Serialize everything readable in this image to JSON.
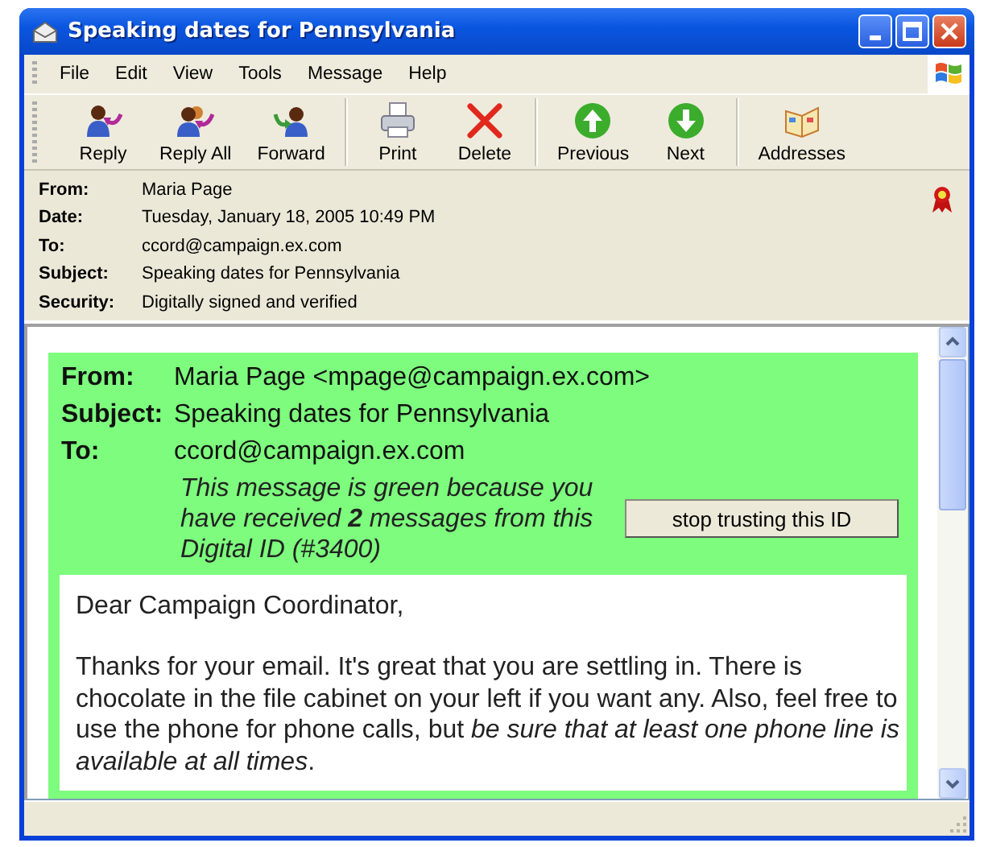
{
  "window": {
    "title": "Speaking dates for Pennsylvania"
  },
  "menu": [
    "File",
    "Edit",
    "View",
    "Tools",
    "Message",
    "Help"
  ],
  "toolbar": [
    {
      "label": "Reply",
      "kind": "reply",
      "separator_after": false
    },
    {
      "label": "Reply All",
      "kind": "reply_all",
      "separator_after": false
    },
    {
      "label": "Forward",
      "kind": "forward",
      "separator_after": true
    },
    {
      "label": "Print",
      "kind": "print",
      "separator_after": false
    },
    {
      "label": "Delete",
      "kind": "delete",
      "separator_after": true
    },
    {
      "label": "Previous",
      "kind": "previous",
      "separator_after": false
    },
    {
      "label": "Next",
      "kind": "next",
      "separator_after": true
    },
    {
      "label": "Addresses",
      "kind": "addresses",
      "separator_after": false
    }
  ],
  "headers": [
    {
      "label": "From:",
      "value": "Maria Page"
    },
    {
      "label": "Date:",
      "value": "Tuesday, January 18, 2005 10:49 PM"
    },
    {
      "label": "To:",
      "value": "ccord@campaign.ex.com"
    },
    {
      "label": "Subject:",
      "value": "Speaking dates for Pennsylvania"
    },
    {
      "label": "Security:",
      "value": "Digitally signed and verified"
    }
  ],
  "message": {
    "fields": [
      {
        "label": "From:",
        "value": "Maria Page <mpage@campaign.ex.com>"
      },
      {
        "label": "Subject:",
        "value": "Speaking dates for Pennsylvania"
      },
      {
        "label": "To:",
        "value": "ccord@campaign.ex.com"
      }
    ],
    "trust_note": "This message is green because you have received **2** messages from this Digital ID (#3400)",
    "trust_button": "stop trusting this ID",
    "greeting": "Dear Campaign Coordinator,",
    "paragraph": "Thanks for your email. It's great that you are settling in. There is chocolate in the file cabinet on your left if you want any. Also, feel free to use the phone for phone calls, but *be sure that at least one phone line is available at all times*."
  }
}
